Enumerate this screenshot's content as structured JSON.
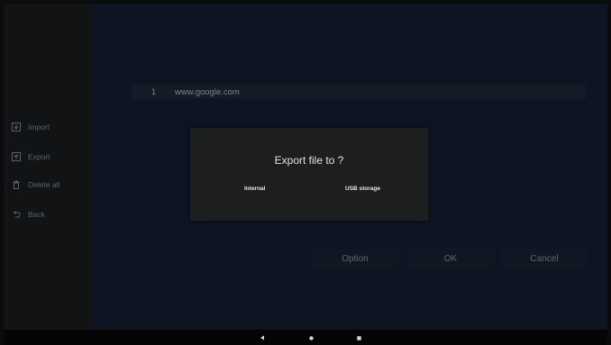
{
  "sidebar": {
    "items": [
      {
        "label": "Import",
        "icon": "import-icon"
      },
      {
        "label": "Export",
        "icon": "export-icon"
      },
      {
        "label": "Delete all",
        "icon": "trash-icon"
      },
      {
        "label": "Back",
        "icon": "back-arrow-icon"
      }
    ]
  },
  "list": {
    "rows": [
      {
        "index": "1",
        "url": "www.google.com"
      }
    ]
  },
  "actions": {
    "option_label": "Option",
    "ok_label": "OK",
    "cancel_label": "Cancel"
  },
  "dialog": {
    "title": "Export file to ?",
    "options": [
      "Internal",
      "USB storage"
    ]
  },
  "navbar": {
    "icons": [
      "back-icon",
      "home-icon",
      "recents-icon"
    ]
  },
  "colors": {
    "main_background": "#0f1422",
    "sidebar_background": "#121314",
    "dialog_background": "#1d1e20"
  }
}
